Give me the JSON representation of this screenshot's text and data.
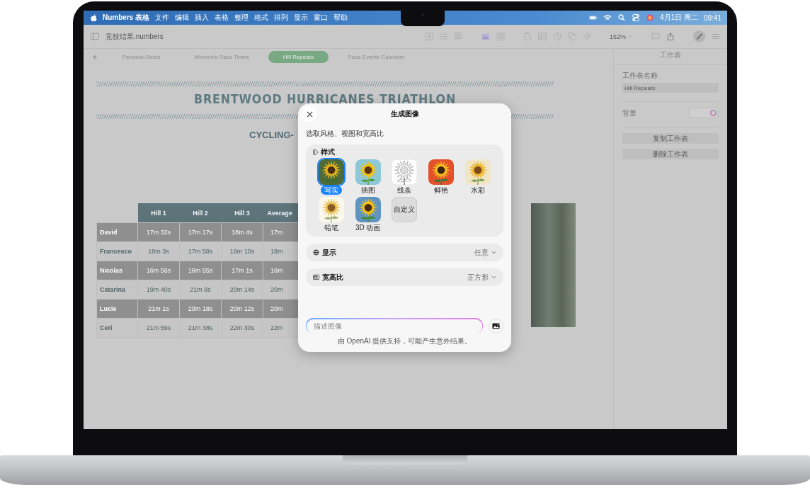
{
  "menu_bar": {
    "app": "Numbers 表格",
    "items": [
      "文件",
      "编辑",
      "插入",
      "表格",
      "整理",
      "格式",
      "排列",
      "显示",
      "窗口",
      "帮助"
    ],
    "date": "4月1日 周二",
    "time": "09:41"
  },
  "toolbar": {
    "document_title": "竞技结果.numbers",
    "zoom": "152%"
  },
  "add_sheet": "+",
  "tabs": [
    {
      "label": "Personal Bests",
      "selected": false
    },
    {
      "label": "Women's Race Times",
      "selected": false
    },
    {
      "label": "Hill Repeats",
      "selected": true
    },
    {
      "label": "Race Events Calendar",
      "selected": false
    }
  ],
  "sheet": {
    "title": "BRENTWOOD HURRICANES TRIATHLON",
    "subtitle": "CYCLING-",
    "table": {
      "columns": [
        "Hill 1",
        "Hill 2",
        "Hill 3",
        "Average"
      ],
      "rows": [
        {
          "name": "David",
          "cells": [
            "17m 32s",
            "17m 17s",
            "18m 4s",
            "17m"
          ]
        },
        {
          "name": "Francesco",
          "cells": [
            "18m 3s",
            "17m 58s",
            "18m 10s",
            "18m"
          ]
        },
        {
          "name": "Nicolas",
          "cells": [
            "16m 56s",
            "16m 55s",
            "17m 1s",
            "16m"
          ]
        },
        {
          "name": "Catarina",
          "cells": [
            "19m 40s",
            "21m 8s",
            "20m 14s",
            "20m"
          ]
        },
        {
          "name": "Lucie",
          "cells": [
            "21m 1s",
            "20m 18s",
            "20m 12s",
            "20m"
          ]
        },
        {
          "name": "Ceri",
          "cells": [
            "21m 59s",
            "21m 38s",
            "22m 30s",
            "22m"
          ]
        }
      ]
    }
  },
  "sidebar": {
    "header": "工作表",
    "name_label": "工作表名称",
    "name_value": "Hill Repeats",
    "background_label": "背景",
    "buttons": [
      "复制工作表",
      "删除工作表"
    ]
  },
  "dialog": {
    "title": "生成图像",
    "subtitle": "选取风格、视图和宽高比",
    "style_heading": "样式",
    "styles": [
      {
        "label": "写实",
        "kind": "photo",
        "selected": true
      },
      {
        "label": "插图",
        "kind": "illustration",
        "selected": false
      },
      {
        "label": "线条",
        "kind": "line",
        "selected": false
      },
      {
        "label": "鲜艳",
        "kind": "vivid",
        "selected": false
      },
      {
        "label": "水彩",
        "kind": "watercolor",
        "selected": false
      },
      {
        "label": "铅笔",
        "kind": "pencil",
        "selected": false
      },
      {
        "label": "3D 动画",
        "kind": "animation",
        "selected": false
      },
      {
        "label": "自定义",
        "kind": "custom",
        "selected": false
      }
    ],
    "options": [
      {
        "label": "显示",
        "value": "任意",
        "kind": "view"
      },
      {
        "label": "宽高比",
        "value": "正方形",
        "kind": "ratio"
      }
    ],
    "prompt": {
      "placeholder": "描述图像"
    },
    "footer": "由 OpenAI 提供支持，可能产生意外结果。"
  }
}
